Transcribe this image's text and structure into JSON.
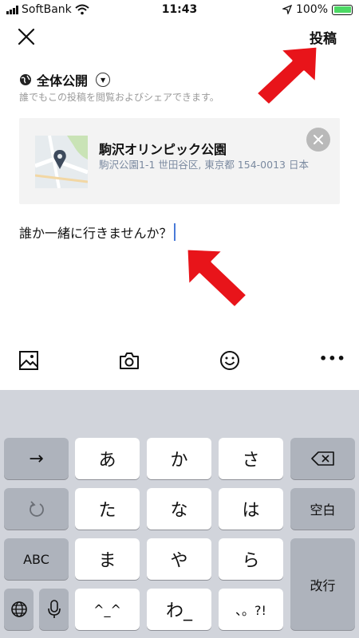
{
  "status_bar": {
    "carrier": "SoftBank",
    "time": "11:43",
    "battery": "100%"
  },
  "header": {
    "post_label": "投稿"
  },
  "privacy": {
    "label": "全体公開",
    "note": "誰でもこの投稿を閲覧およびシェアできます。"
  },
  "location": {
    "name": "駒沢オリンピック公園",
    "address": "駒沢公園1-1 世田谷区, 東京都 154-0013 日本"
  },
  "post": {
    "text": "誰か一緒に行きませんか？"
  },
  "toolbar": {
    "more_label": "•••"
  },
  "keyboard": {
    "arrow_key": "→",
    "row1": [
      "あ",
      "か",
      "さ"
    ],
    "row2": [
      "た",
      "な",
      "は"
    ],
    "row3": [
      "ま",
      "や",
      "ら"
    ],
    "row4": [
      "^_^",
      "わ_",
      "、。?!"
    ],
    "space_label": "空白",
    "abc_label": "ABC",
    "enter_label": "改行"
  },
  "colors": {
    "accent": "#4a7bd8",
    "arrow_red": "#e8141a",
    "keyboard_bg": "#d1d4db"
  }
}
